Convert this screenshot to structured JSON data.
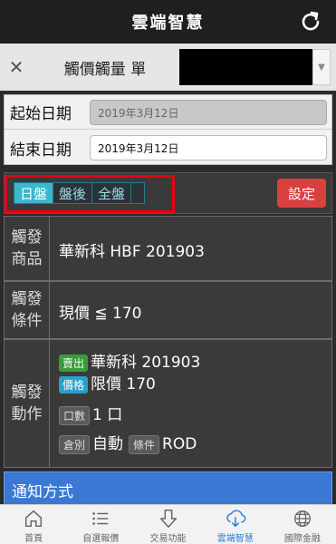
{
  "appbar": {
    "title": "雲端智慧",
    "refresh_icon": "refresh-icon"
  },
  "subheader": {
    "close_icon": "close-icon",
    "title": "觸價觸量 單"
  },
  "dates": {
    "start_label": "起始日期",
    "start_value": "2019年3月12日",
    "end_label": "結束日期",
    "end_value": "2019年3月12日"
  },
  "session": {
    "tabs": [
      {
        "label": "日盤",
        "active": true
      },
      {
        "label": "盤後",
        "active": false
      },
      {
        "label": "全盤",
        "active": false
      }
    ],
    "setting_label": "設定"
  },
  "trigger": {
    "product_label_1": "觸發",
    "product_label_2": "商品",
    "product_value": "華新科 HBF 201903",
    "condition_label_1": "觸發",
    "condition_label_2": "條件",
    "condition_value": "現價 ≦ 170",
    "action_label_1": "觸發",
    "action_label_2": "動作",
    "action": {
      "side_badge": "賣出",
      "side_value": "華新科 201903",
      "price_badge": "價格",
      "price_value": "限價 170",
      "qty_badge": "口數",
      "qty_value": "1 口",
      "pos_badge": "倉別",
      "pos_value": "自動",
      "cond_badge": "條件",
      "cond_value": "ROD"
    }
  },
  "notify": {
    "label": "通知方式"
  },
  "nav": {
    "items": [
      {
        "label": "首頁",
        "icon": "home-icon",
        "active": false
      },
      {
        "label": "自選報價",
        "icon": "list-icon",
        "active": false
      },
      {
        "label": "交易功能",
        "icon": "download-arrow-icon",
        "active": false
      },
      {
        "label": "雲端智慧",
        "icon": "cloud-download-icon",
        "active": true
      },
      {
        "label": "國際金融",
        "icon": "globe-icon",
        "active": false
      }
    ]
  },
  "colors": {
    "accent": "#3ab8cc",
    "setting": "#d9413f",
    "notify": "#3a78d4",
    "highlight_box": "#e60012"
  }
}
